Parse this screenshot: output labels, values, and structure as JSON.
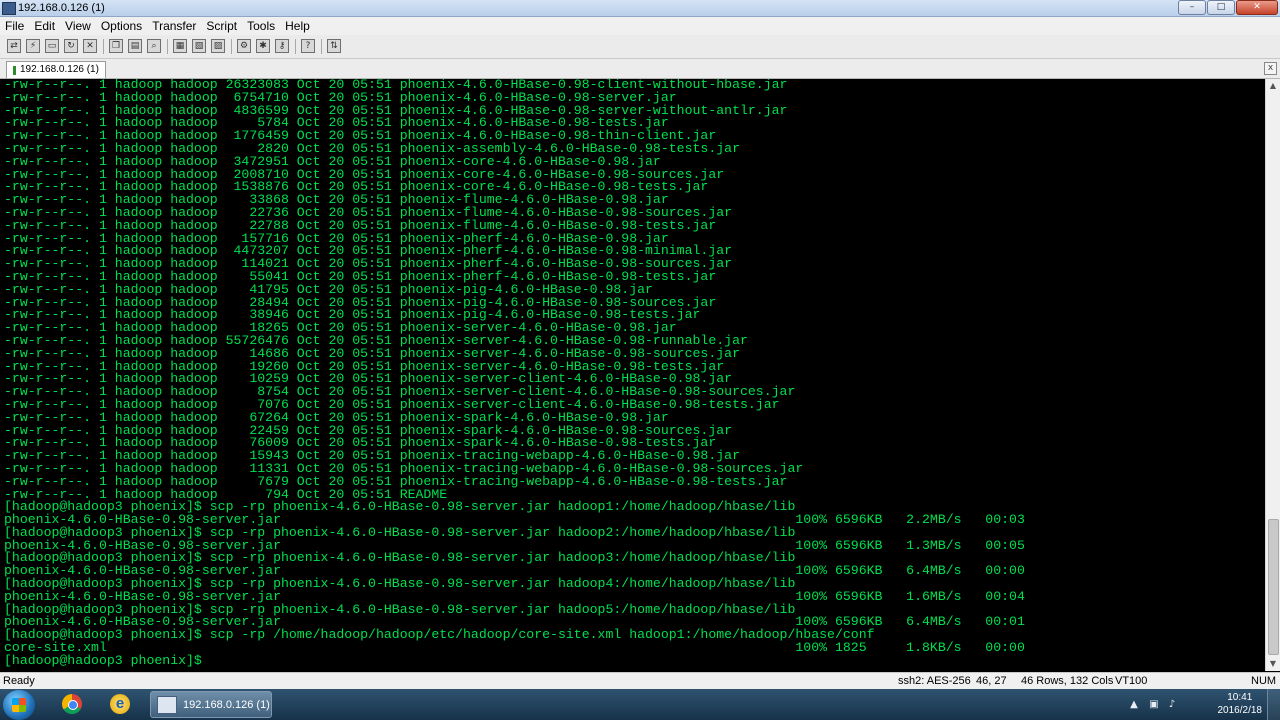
{
  "window": {
    "title": "192.168.0.126 (1)",
    "buttons": {
      "minimize": "–",
      "maximize": "□",
      "close": "✕"
    }
  },
  "menu": {
    "items": [
      "File",
      "Edit",
      "View",
      "Options",
      "Transfer",
      "Script",
      "Tools",
      "Help"
    ]
  },
  "toolbar": {
    "icons": [
      "connect-icon",
      "quick-connect-icon",
      "connect-in-tab-icon",
      "reconnect-icon",
      "disconnect-icon",
      "copy-icon",
      "paste-icon",
      "find-icon",
      "print-icon",
      "print-setup-icon",
      "print-selection-icon",
      "session-options-icon",
      "global-options-icon",
      "key-map-icon",
      "help-icon",
      "sftp-icon"
    ]
  },
  "tab": {
    "label": "192.168.0.126 (1)",
    "close": "x"
  },
  "terminal": {
    "lines": [
      "-rw-r--r--. 1 hadoop hadoop 26323083 Oct 20 05:51 phoenix-4.6.0-HBase-0.98-client-without-hbase.jar",
      "-rw-r--r--. 1 hadoop hadoop  6754710 Oct 20 05:51 phoenix-4.6.0-HBase-0.98-server.jar",
      "-rw-r--r--. 1 hadoop hadoop  4836599 Oct 20 05:51 phoenix-4.6.0-HBase-0.98-server-without-antlr.jar",
      "-rw-r--r--. 1 hadoop hadoop     5784 Oct 20 05:51 phoenix-4.6.0-HBase-0.98-tests.jar",
      "-rw-r--r--. 1 hadoop hadoop  1776459 Oct 20 05:51 phoenix-4.6.0-HBase-0.98-thin-client.jar",
      "-rw-r--r--. 1 hadoop hadoop     2820 Oct 20 05:51 phoenix-assembly-4.6.0-HBase-0.98-tests.jar",
      "-rw-r--r--. 1 hadoop hadoop  3472951 Oct 20 05:51 phoenix-core-4.6.0-HBase-0.98.jar",
      "-rw-r--r--. 1 hadoop hadoop  2008710 Oct 20 05:51 phoenix-core-4.6.0-HBase-0.98-sources.jar",
      "-rw-r--r--. 1 hadoop hadoop  1538876 Oct 20 05:51 phoenix-core-4.6.0-HBase-0.98-tests.jar",
      "-rw-r--r--. 1 hadoop hadoop    33868 Oct 20 05:51 phoenix-flume-4.6.0-HBase-0.98.jar",
      "-rw-r--r--. 1 hadoop hadoop    22736 Oct 20 05:51 phoenix-flume-4.6.0-HBase-0.98-sources.jar",
      "-rw-r--r--. 1 hadoop hadoop    22788 Oct 20 05:51 phoenix-flume-4.6.0-HBase-0.98-tests.jar",
      "-rw-r--r--. 1 hadoop hadoop   157716 Oct 20 05:51 phoenix-pherf-4.6.0-HBase-0.98.jar",
      "-rw-r--r--. 1 hadoop hadoop  4473207 Oct 20 05:51 phoenix-pherf-4.6.0-HBase-0.98-minimal.jar",
      "-rw-r--r--. 1 hadoop hadoop   114021 Oct 20 05:51 phoenix-pherf-4.6.0-HBase-0.98-sources.jar",
      "-rw-r--r--. 1 hadoop hadoop    55041 Oct 20 05:51 phoenix-pherf-4.6.0-HBase-0.98-tests.jar",
      "-rw-r--r--. 1 hadoop hadoop    41795 Oct 20 05:51 phoenix-pig-4.6.0-HBase-0.98.jar",
      "-rw-r--r--. 1 hadoop hadoop    28494 Oct 20 05:51 phoenix-pig-4.6.0-HBase-0.98-sources.jar",
      "-rw-r--r--. 1 hadoop hadoop    38946 Oct 20 05:51 phoenix-pig-4.6.0-HBase-0.98-tests.jar",
      "-rw-r--r--. 1 hadoop hadoop    18265 Oct 20 05:51 phoenix-server-4.6.0-HBase-0.98.jar",
      "-rw-r--r--. 1 hadoop hadoop 55726476 Oct 20 05:51 phoenix-server-4.6.0-HBase-0.98-runnable.jar",
      "-rw-r--r--. 1 hadoop hadoop    14686 Oct 20 05:51 phoenix-server-4.6.0-HBase-0.98-sources.jar",
      "-rw-r--r--. 1 hadoop hadoop    19260 Oct 20 05:51 phoenix-server-4.6.0-HBase-0.98-tests.jar",
      "-rw-r--r--. 1 hadoop hadoop    10259 Oct 20 05:51 phoenix-server-client-4.6.0-HBase-0.98.jar",
      "-rw-r--r--. 1 hadoop hadoop     8754 Oct 20 05:51 phoenix-server-client-4.6.0-HBase-0.98-sources.jar",
      "-rw-r--r--. 1 hadoop hadoop     7076 Oct 20 05:51 phoenix-server-client-4.6.0-HBase-0.98-tests.jar",
      "-rw-r--r--. 1 hadoop hadoop    67264 Oct 20 05:51 phoenix-spark-4.6.0-HBase-0.98.jar",
      "-rw-r--r--. 1 hadoop hadoop    22459 Oct 20 05:51 phoenix-spark-4.6.0-HBase-0.98-sources.jar",
      "-rw-r--r--. 1 hadoop hadoop    76009 Oct 20 05:51 phoenix-spark-4.6.0-HBase-0.98-tests.jar",
      "-rw-r--r--. 1 hadoop hadoop    15943 Oct 20 05:51 phoenix-tracing-webapp-4.6.0-HBase-0.98.jar",
      "-rw-r--r--. 1 hadoop hadoop    11331 Oct 20 05:51 phoenix-tracing-webapp-4.6.0-HBase-0.98-sources.jar",
      "-rw-r--r--. 1 hadoop hadoop     7679 Oct 20 05:51 phoenix-tracing-webapp-4.6.0-HBase-0.98-tests.jar",
      "-rw-r--r--. 1 hadoop hadoop      794 Oct 20 05:51 README",
      "[hadoop@hadoop3 phoenix]$ scp -rp phoenix-4.6.0-HBase-0.98-server.jar hadoop1:/home/hadoop/hbase/lib",
      "phoenix-4.6.0-HBase-0.98-server.jar                                                                 100% 6596KB   2.2MB/s   00:03",
      "[hadoop@hadoop3 phoenix]$ scp -rp phoenix-4.6.0-HBase-0.98-server.jar hadoop2:/home/hadoop/hbase/lib",
      "phoenix-4.6.0-HBase-0.98-server.jar                                                                 100% 6596KB   1.3MB/s   00:05",
      "[hadoop@hadoop3 phoenix]$ scp -rp phoenix-4.6.0-HBase-0.98-server.jar hadoop3:/home/hadoop/hbase/lib",
      "phoenix-4.6.0-HBase-0.98-server.jar                                                                 100% 6596KB   6.4MB/s   00:00",
      "[hadoop@hadoop3 phoenix]$ scp -rp phoenix-4.6.0-HBase-0.98-server.jar hadoop4:/home/hadoop/hbase/lib",
      "phoenix-4.6.0-HBase-0.98-server.jar                                                                 100% 6596KB   1.6MB/s   00:04",
      "[hadoop@hadoop3 phoenix]$ scp -rp phoenix-4.6.0-HBase-0.98-server.jar hadoop5:/home/hadoop/hbase/lib",
      "phoenix-4.6.0-HBase-0.98-server.jar                                                                 100% 6596KB   6.4MB/s   00:01",
      "[hadoop@hadoop3 phoenix]$ scp -rp /home/hadoop/hadoop/etc/hadoop/core-site.xml hadoop1:/home/hadoop/hbase/conf",
      "core-site.xml                                                                                       100% 1825     1.8KB/s   00:00",
      "[hadoop@hadoop3 phoenix]$"
    ]
  },
  "scrollbar": {
    "up": "▲",
    "down": "▼"
  },
  "status": {
    "ready": "Ready",
    "encryption": "ssh2: AES-256",
    "cursor": "46,  27",
    "size": "46 Rows, 132 Cols",
    "emulation": "VT100",
    "num": "NUM"
  },
  "taskbar": {
    "ie_glyph": "e",
    "window_label": "192.168.0.126 (1)",
    "tray": {
      "up": "▲",
      "network": "▣",
      "volume": "♪"
    },
    "clock_time": "10:41",
    "clock_date": "2016/2/18"
  },
  "colors": {
    "terminal_fg": "#00e04e",
    "terminal_bg": "#000000"
  }
}
